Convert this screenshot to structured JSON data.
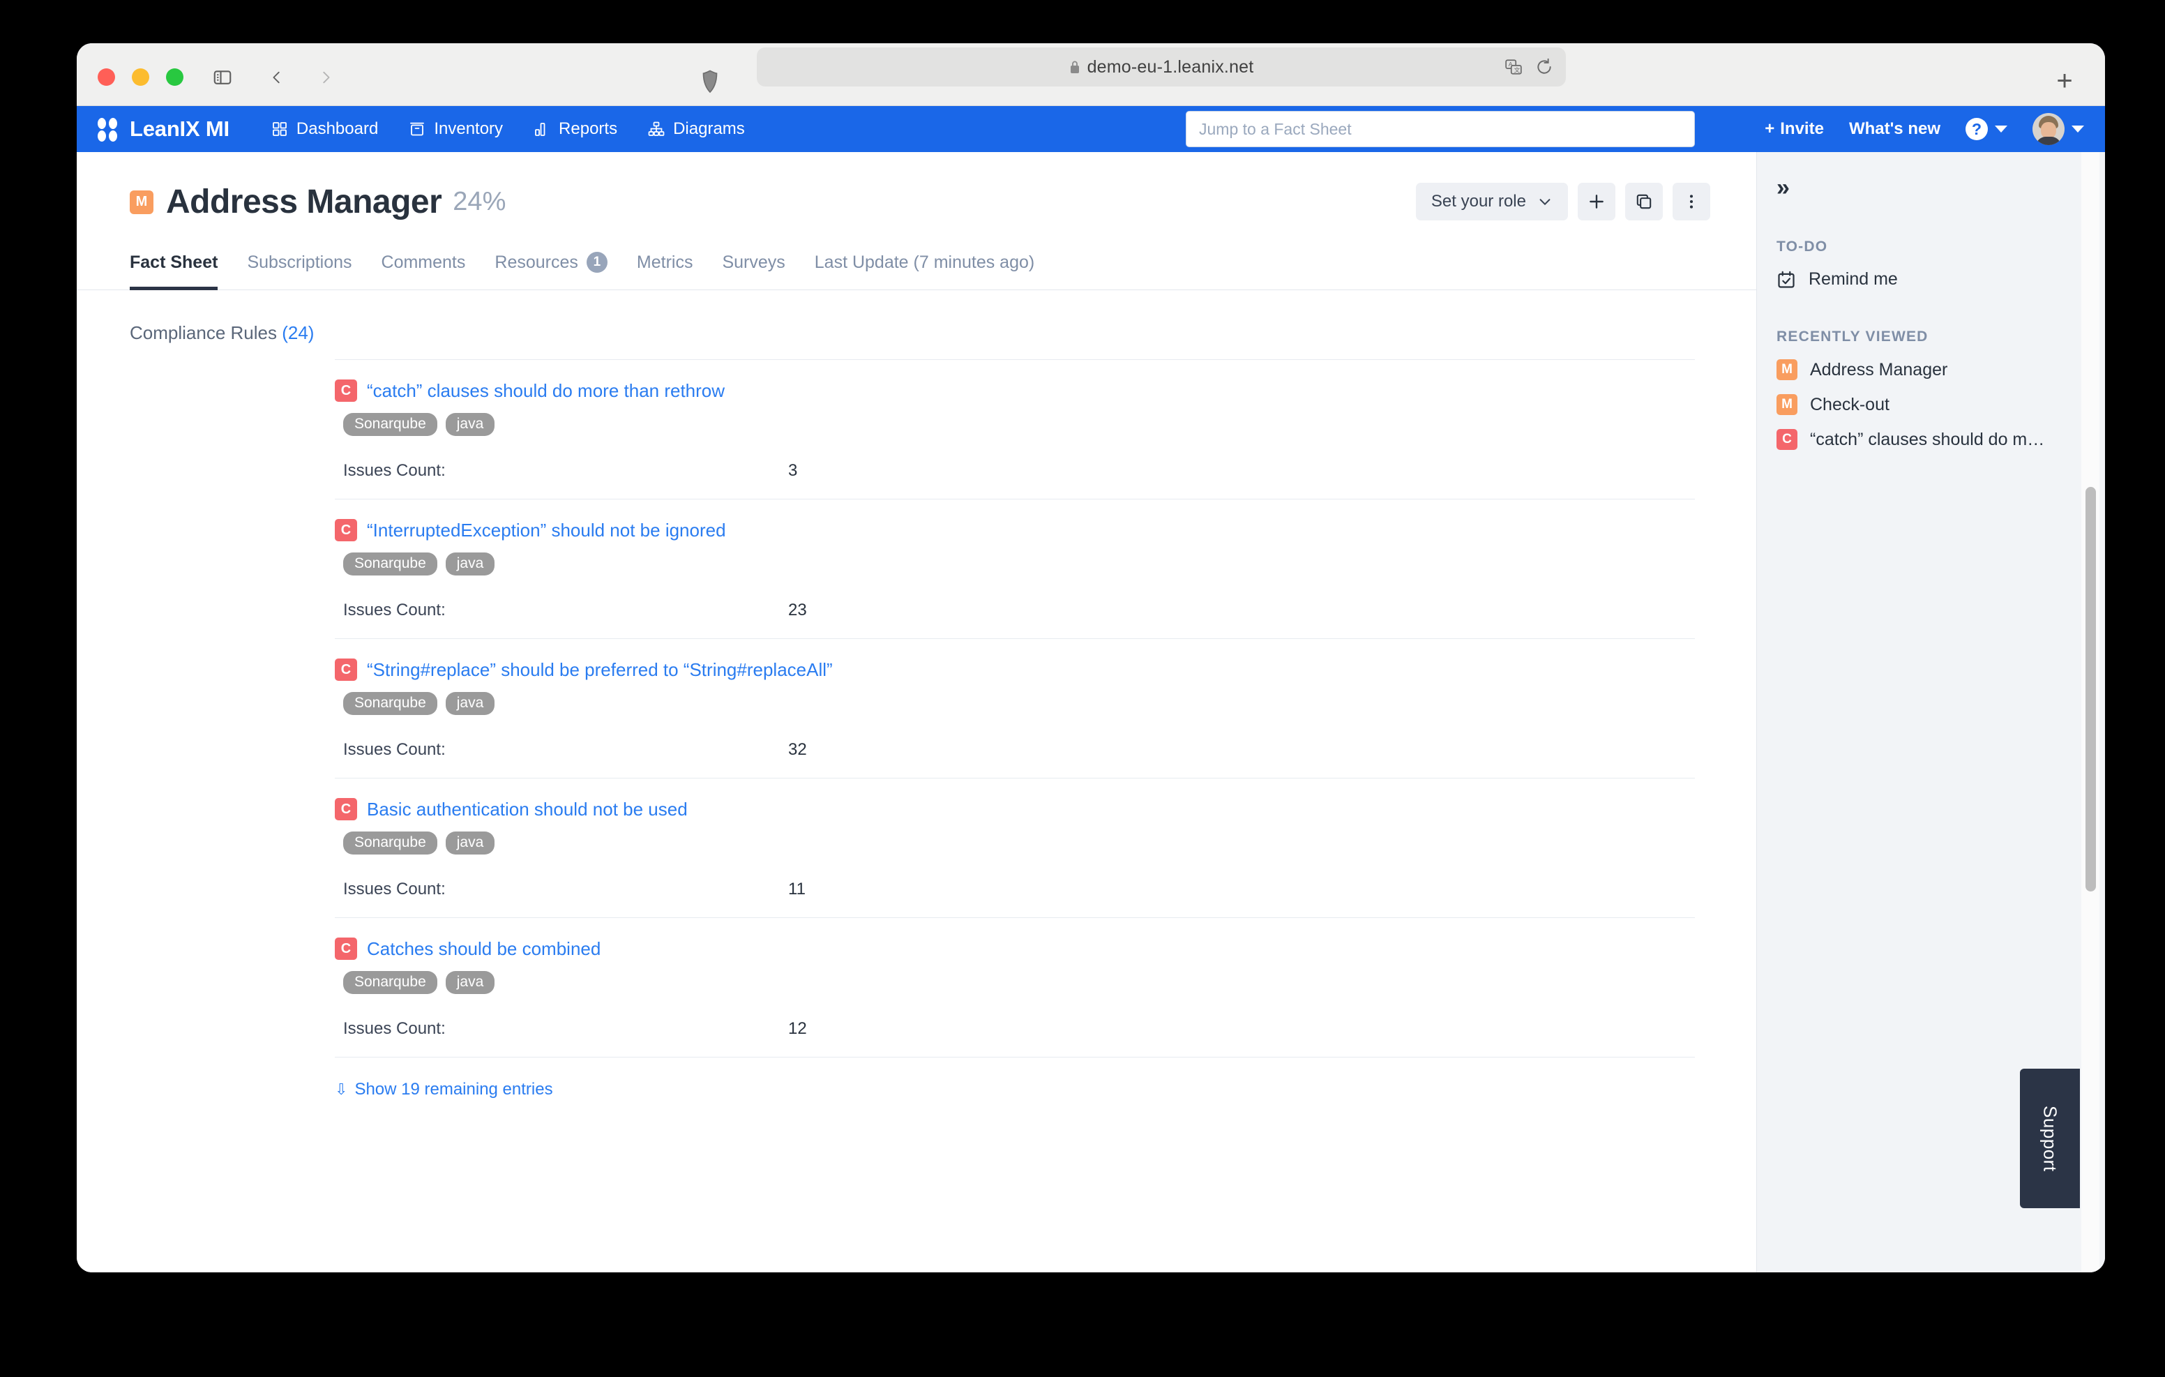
{
  "browser": {
    "url": "demo-eu-1.leanix.net",
    "lock_icon": "lock-icon",
    "shield_icon": "shield-icon",
    "sidebar_icon": "sidebar-toggle-icon",
    "back_icon": "chevron-left-icon",
    "forward_icon": "chevron-right-icon",
    "translate_icon": "translate-icon",
    "reload_icon": "reload-icon",
    "newtab_label": "+"
  },
  "appnav": {
    "brand": "LeanIX MI",
    "links": [
      {
        "label": "Dashboard",
        "icon": "grid-icon"
      },
      {
        "label": "Inventory",
        "icon": "archive-icon"
      },
      {
        "label": "Reports",
        "icon": "bar-chart-icon"
      },
      {
        "label": "Diagrams",
        "icon": "hierarchy-icon"
      }
    ],
    "search_placeholder": "Jump to a Fact Sheet",
    "search_value": "",
    "invite_label": "Invite",
    "invite_prefix": "+",
    "whats_new_label": "What's new",
    "help_glyph": "?"
  },
  "header": {
    "badge": "M",
    "title": "Address Manager",
    "completion": "24%",
    "role_button": "Set your role",
    "add_icon": "plus-icon",
    "copy_icon": "duplicate-icon",
    "more_icon": "more-vertical-icon"
  },
  "tabs": [
    {
      "label": "Fact Sheet",
      "active": true,
      "badge": ""
    },
    {
      "label": "Subscriptions",
      "active": false,
      "badge": ""
    },
    {
      "label": "Comments",
      "active": false,
      "badge": ""
    },
    {
      "label": "Resources",
      "active": false,
      "badge": "1"
    },
    {
      "label": "Metrics",
      "active": false,
      "badge": ""
    },
    {
      "label": "Surveys",
      "active": false,
      "badge": ""
    },
    {
      "label": "Last Update (7 minutes ago)",
      "active": false,
      "badge": ""
    }
  ],
  "section": {
    "label": "Compliance Rules",
    "count": "(24)"
  },
  "rules": [
    {
      "badge": "C",
      "title": "“catch” clauses should do more than rethrow",
      "tags": [
        "Sonarqube",
        "java"
      ],
      "meta_label": "Issues Count:",
      "meta_value": "3"
    },
    {
      "badge": "C",
      "title": "“InterruptedException” should not be ignored",
      "tags": [
        "Sonarqube",
        "java"
      ],
      "meta_label": "Issues Count:",
      "meta_value": "23"
    },
    {
      "badge": "C",
      "title": "“String#replace” should be preferred to “String#replaceAll”",
      "tags": [
        "Sonarqube",
        "java"
      ],
      "meta_label": "Issues Count:",
      "meta_value": "32"
    },
    {
      "badge": "C",
      "title": "Basic authentication should not be used",
      "tags": [
        "Sonarqube",
        "java"
      ],
      "meta_label": "Issues Count:",
      "meta_value": "11"
    },
    {
      "badge": "C",
      "title": "Catches should be combined",
      "tags": [
        "Sonarqube",
        "java"
      ],
      "meta_label": "Issues Count:",
      "meta_value": "12"
    }
  ],
  "show_more": {
    "chevron": "»",
    "label": "Show 19 remaining entries"
  },
  "sidebar": {
    "collapse_glyph": "»",
    "todo_title": "TO-DO",
    "todo_items": [
      {
        "icon": "calendar-check-icon",
        "label": "Remind me"
      }
    ],
    "recent_title": "RECENTLY VIEWED",
    "recent_items": [
      {
        "badge": "M",
        "badge_type": "m",
        "label": "Address Manager"
      },
      {
        "badge": "M",
        "badge_type": "m",
        "label": "Check-out"
      },
      {
        "badge": "C",
        "badge_type": "c",
        "label": "“catch” clauses should do m…"
      }
    ]
  },
  "support": {
    "label": "Support"
  },
  "colors": {
    "nav_blue": "#1a67e8",
    "link_blue": "#2a7cf0",
    "badge_orange": "#f99d5f",
    "badge_red": "#f4666b",
    "tag_gray": "#9a9a9a",
    "dark": "#29323e",
    "sidebar_bg": "#f2f4f7",
    "support_bg": "#2b3446"
  }
}
